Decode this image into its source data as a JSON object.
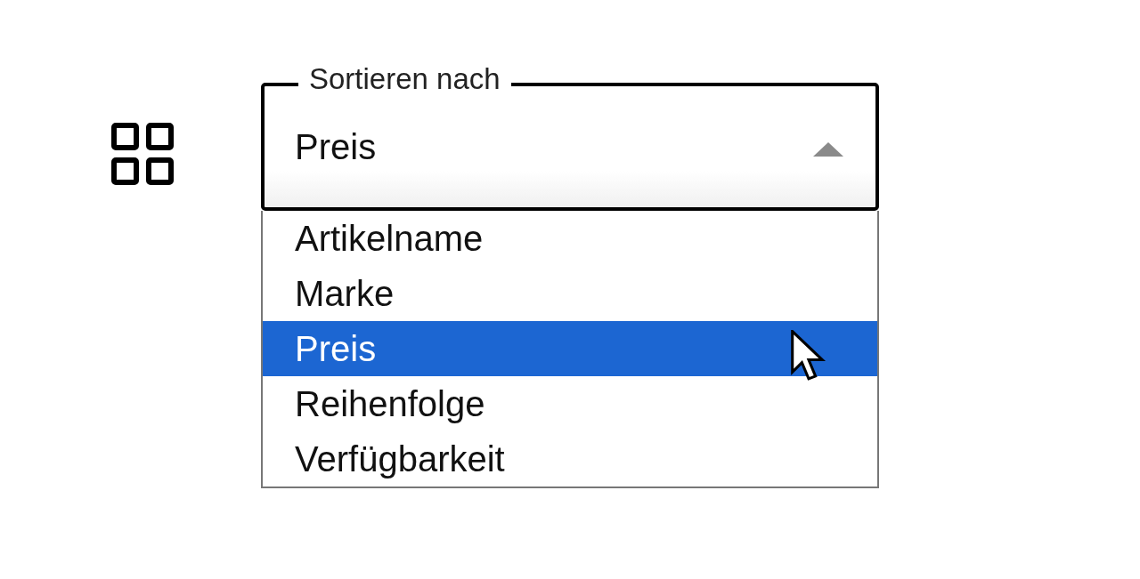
{
  "sort_select": {
    "label": "Sortieren nach",
    "value": "Preis",
    "expanded": true,
    "options": [
      {
        "label": "Artikelname",
        "selected": false
      },
      {
        "label": "Marke",
        "selected": false
      },
      {
        "label": "Preis",
        "selected": true
      },
      {
        "label": "Reihenfolge",
        "selected": false
      },
      {
        "label": "Verfügbarkeit",
        "selected": false
      }
    ]
  }
}
